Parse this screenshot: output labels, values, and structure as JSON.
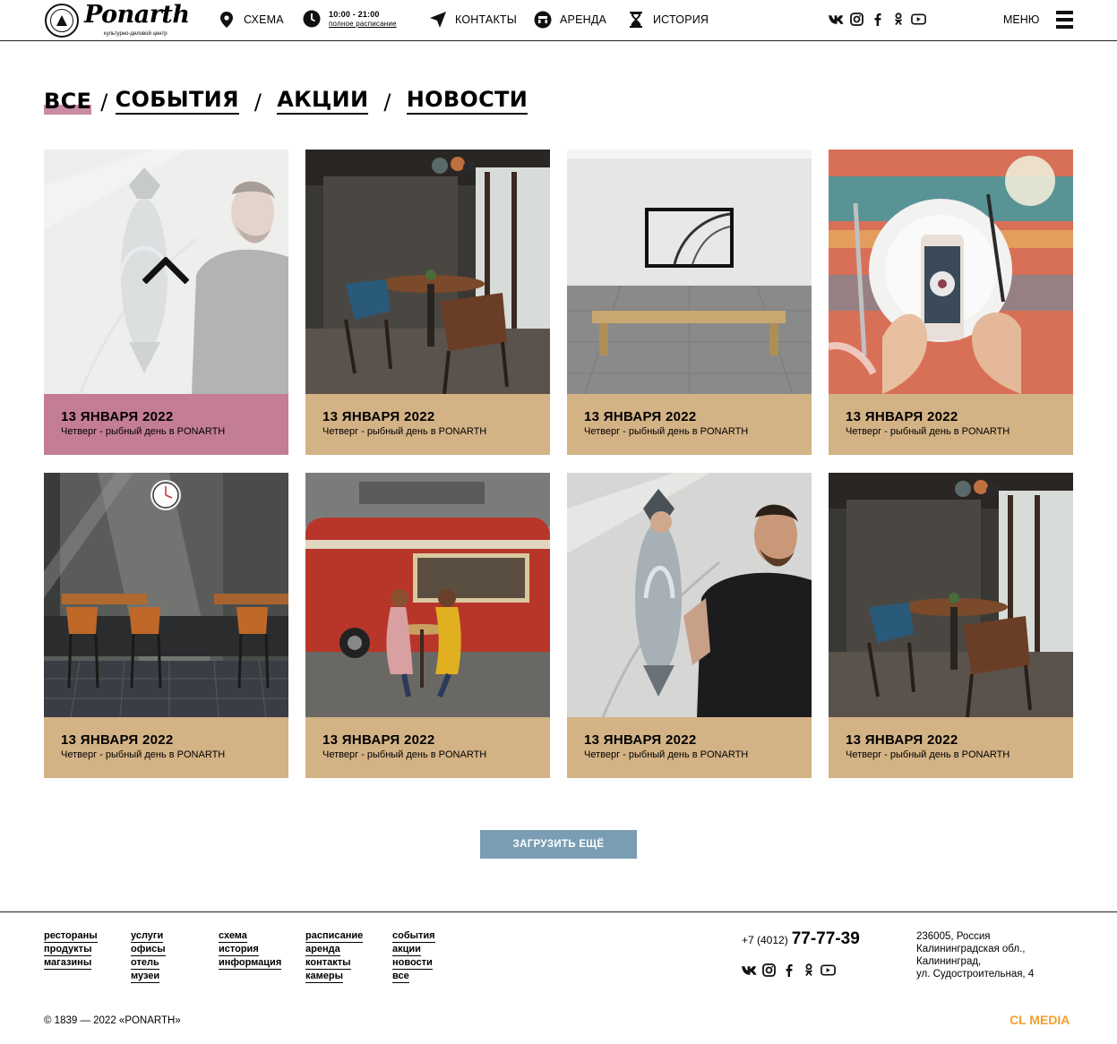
{
  "header": {
    "logo_word": "Ponarth",
    "logo_sub": "культурно-деловой центр",
    "nav": {
      "scheme": "Схема",
      "hours_time": "10:00 - 21:00",
      "hours_link": "полное расписание",
      "contacts": "Контакты",
      "rent": "Аренда",
      "history": "История"
    },
    "socials": [
      "vk-icon",
      "instagram-icon",
      "facebook-icon",
      "odnoklassniki-icon",
      "youtube-icon"
    ],
    "menu_label": "Меню"
  },
  "tabs": {
    "all": "Все",
    "events": "События",
    "promos": "Акции",
    "news": "Новости",
    "separator": "/"
  },
  "cards": [
    {
      "date": "13 ЯНВАРЯ 2022",
      "text": "Четверг - рыбный день в PONARTH",
      "image": "chef-with-fish",
      "highlighted": true
    },
    {
      "date": "13 ЯНВАРЯ 2022",
      "text": "Четверг - рыбный день в PONARTH",
      "image": "cafe-interior"
    },
    {
      "date": "13 ЯНВАРЯ 2022",
      "text": "Четверг - рыбный день в PONARTH",
      "image": "gallery-bench"
    },
    {
      "date": "13 ЯНВАРЯ 2022",
      "text": "Четверг - рыбный день в PONARTH",
      "image": "phone-food-photo"
    },
    {
      "date": "13 ЯНВАРЯ 2022",
      "text": "Четверг - рыбный день в PONARTH",
      "image": "bar-with-clock"
    },
    {
      "date": "13 ЯНВАРЯ 2022",
      "text": "Четверг - рыбный день в PONARTH",
      "image": "red-food-truck"
    },
    {
      "date": "13 ЯНВАРЯ 2022",
      "text": "Четверг - рыбный день в PONARTH",
      "image": "chef-with-fish"
    },
    {
      "date": "13 ЯНВАРЯ 2022",
      "text": "Четверг - рыбный день в PONARTH",
      "image": "cafe-interior"
    }
  ],
  "load_more": "Загрузить ещё",
  "footer": {
    "col1": [
      "рестораны",
      "продукты",
      "магазины"
    ],
    "col2": [
      "услуги",
      "офисы",
      "отель",
      "музеи"
    ],
    "col3": [
      "схема",
      "история",
      "информация"
    ],
    "col4": [
      "расписание",
      "аренда",
      "контакты",
      "камеры"
    ],
    "col5": [
      "события",
      "акции",
      "новости",
      "все"
    ],
    "phone_prefix": "+7 (4012)",
    "phone_number": "77-77-39",
    "address": [
      "236005, Россия",
      "Калининградская обл.,",
      "Калининград,",
      "ул. Судостроительная, 4"
    ],
    "copyright": "© 1839 — 2022 «PONARTH»",
    "credit": "CL MEDIA"
  },
  "colors": {
    "caption_beige": "#d3b285",
    "caption_pink": "#c47d96",
    "tab_highlight": "#c98ba3",
    "button_blue": "#7b9db3",
    "credit_orange": "#f0a030"
  }
}
